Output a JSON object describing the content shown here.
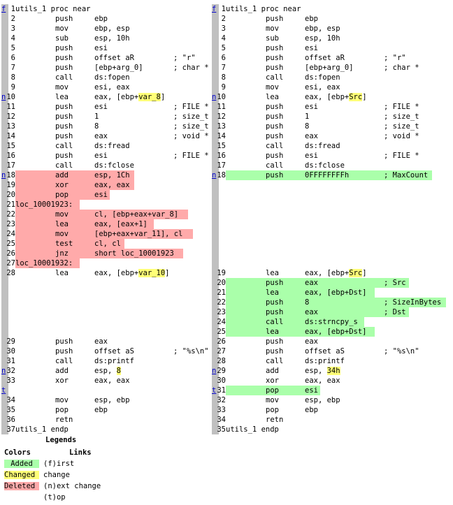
{
  "left_lines": [
    {
      "gutter": "f",
      "num": "1",
      "label": "utils_1 proc near",
      "instr": "",
      "ops": "",
      "comment": ""
    },
    {
      "num": "2",
      "instr": "push",
      "ops": "ebp"
    },
    {
      "num": "3",
      "instr": "mov",
      "ops": "ebp, esp"
    },
    {
      "num": "4",
      "instr": "sub",
      "ops": "esp, 10h"
    },
    {
      "num": "5",
      "instr": "push",
      "ops": "esi"
    },
    {
      "num": "6",
      "instr": "push",
      "ops": "offset aR",
      "comment": "; \"r\""
    },
    {
      "num": "7",
      "instr": "push",
      "ops": "[ebp+arg_0]",
      "comment": "; char *"
    },
    {
      "num": "8",
      "instr": "call",
      "ops": "ds:fopen"
    },
    {
      "num": "9",
      "instr": "mov",
      "ops": "esi, eax"
    },
    {
      "gutter": "n",
      "num": "10",
      "instr": "lea",
      "ops_pre": "eax, [ebp+",
      "ops_chg": "var_8",
      "ops_post": "]"
    },
    {
      "num": "11",
      "instr": "push",
      "ops": "esi",
      "comment": "; FILE *"
    },
    {
      "num": "12",
      "instr": "push",
      "ops": "1",
      "comment": "; size_t"
    },
    {
      "num": "13",
      "instr": "push",
      "ops": "8",
      "comment": "; size_t"
    },
    {
      "num": "14",
      "instr": "push",
      "ops": "eax",
      "comment": "; void *"
    },
    {
      "num": "15",
      "instr": "call",
      "ops": "ds:fread"
    },
    {
      "num": "16",
      "instr": "push",
      "ops": "esi",
      "comment": "; FILE *"
    },
    {
      "num": "17",
      "instr": "call",
      "ops": "ds:fclose"
    },
    {
      "gutter": "n",
      "num": "18",
      "instr": "add",
      "ops": "esp, 1Ch",
      "hl": "del",
      "hlw": 190
    },
    {
      "num": "19",
      "instr": "xor",
      "ops": "eax, eax",
      "hl": "del",
      "hlw": 190
    },
    {
      "num": "20",
      "instr": "pop",
      "ops": "esi",
      "hl": "del",
      "hlw": 155
    },
    {
      "num": "21",
      "label": "loc_10001923:",
      "hl": "del",
      "hlw": 112
    },
    {
      "num": "22",
      "instr": "mov",
      "ops": "cl, [ebp+eax+var_8]",
      "hl": "del",
      "hlw": 267
    },
    {
      "num": "23",
      "instr": "lea",
      "ops": "eax, [eax+1]",
      "hl": "del",
      "hlw": 218
    },
    {
      "num": "24",
      "instr": "mov",
      "ops": "[ebp+eax+var_11], cl",
      "hl": "del",
      "hlw": 274
    },
    {
      "num": "25",
      "instr": "test",
      "ops": "cl, cl",
      "hl": "del",
      "hlw": 176
    },
    {
      "num": "26",
      "instr": "jnz",
      "ops": "short loc_10001923",
      "hl": "del",
      "hlw": 260
    },
    {
      "num": "27",
      "label": "loc_10001932:",
      "hl": "del",
      "hlw": 112
    },
    {
      "num": "28",
      "instr": "lea",
      "ops_pre": "eax, [ebp+",
      "ops_chg": "var_10",
      "ops_post": "]"
    },
    {
      "blank": true
    },
    {
      "blank": true
    },
    {
      "blank": true
    },
    {
      "blank": true
    },
    {
      "blank": true
    },
    {
      "blank": true
    },
    {
      "num": "29",
      "instr": "push",
      "ops": "eax"
    },
    {
      "num": "30",
      "instr": "push",
      "ops": "offset aS",
      "comment": "; \"%s\\n\""
    },
    {
      "num": "31",
      "instr": "call",
      "ops": "ds:printf"
    },
    {
      "gutter": "n",
      "num": "32",
      "instr": "add",
      "ops_pre": "esp, ",
      "ops_chg": "8",
      "ops_post": ""
    },
    {
      "num": "33",
      "instr": "xor",
      "ops": "eax, eax"
    },
    {
      "gutter": "t",
      "blank": true
    },
    {
      "num": "34",
      "instr": "mov",
      "ops": "esp, ebp"
    },
    {
      "num": "35",
      "instr": "pop",
      "ops": "ebp"
    },
    {
      "num": "36",
      "instr": "retn",
      "ops": ""
    },
    {
      "num": "37",
      "label": "utils_1 endp"
    }
  ],
  "right_lines": [
    {
      "gutter": "f",
      "num": "1",
      "label": "utils_1 proc near"
    },
    {
      "num": "2",
      "instr": "push",
      "ops": "ebp"
    },
    {
      "num": "3",
      "instr": "mov",
      "ops": "ebp, esp"
    },
    {
      "num": "4",
      "instr": "sub",
      "ops": "esp, 10h"
    },
    {
      "num": "5",
      "instr": "push",
      "ops": "esi"
    },
    {
      "num": "6",
      "instr": "push",
      "ops": "offset aR",
      "comment": "; \"r\""
    },
    {
      "num": "7",
      "instr": "push",
      "ops": "[ebp+arg_0]",
      "comment": "; char *"
    },
    {
      "num": "8",
      "instr": "call",
      "ops": "ds:fopen"
    },
    {
      "num": "9",
      "instr": "mov",
      "ops": "esi, eax"
    },
    {
      "gutter": "n",
      "num": "10",
      "instr": "lea",
      "ops_pre": "eax, [ebp+",
      "ops_chg": "Src",
      "ops_post": "]"
    },
    {
      "num": "11",
      "instr": "push",
      "ops": "esi",
      "comment": "; FILE *"
    },
    {
      "num": "12",
      "instr": "push",
      "ops": "1",
      "comment": "; size_t"
    },
    {
      "num": "13",
      "instr": "push",
      "ops": "8",
      "comment": "; size_t"
    },
    {
      "num": "14",
      "instr": "push",
      "ops": "eax",
      "comment": "; void *"
    },
    {
      "num": "15",
      "instr": "call",
      "ops": "ds:fread"
    },
    {
      "num": "16",
      "instr": "push",
      "ops": "esi",
      "comment": "; FILE *"
    },
    {
      "num": "17",
      "instr": "call",
      "ops": "ds:fclose"
    },
    {
      "gutter": "n",
      "num": "18",
      "instr": "push",
      "ops": "0FFFFFFFFh",
      "comment": "; MaxCount",
      "hl": "add",
      "hlw": 315
    },
    {
      "blank": true
    },
    {
      "blank": true
    },
    {
      "blank": true
    },
    {
      "blank": true
    },
    {
      "blank": true
    },
    {
      "blank": true
    },
    {
      "blank": true
    },
    {
      "blank": true
    },
    {
      "blank": true
    },
    {
      "num": "19",
      "instr": "lea",
      "ops_pre": "eax, [ebp+",
      "ops_chg": "Src",
      "ops_post": "]"
    },
    {
      "num": "20",
      "instr": "push",
      "ops": "eax",
      "comment": "; Src",
      "hl": "add",
      "hlw": 282
    },
    {
      "num": "21",
      "instr": "lea",
      "ops": "eax, [ebp+Dst]",
      "hl": "add",
      "hlw": 233
    },
    {
      "num": "22",
      "instr": "push",
      "ops": "8",
      "comment": "; SizeInBytes",
      "hl": "add",
      "hlw": 335
    },
    {
      "num": "23",
      "instr": "push",
      "ops": "eax",
      "comment": "; Dst",
      "hl": "add",
      "hlw": 282
    },
    {
      "num": "24",
      "instr": "call",
      "ops": "ds:strncpy_s",
      "hl": "add",
      "hlw": 218
    },
    {
      "num": "25",
      "instr": "lea",
      "ops": "eax, [ebp+Dst]",
      "hl": "add",
      "hlw": 233
    },
    {
      "num": "26",
      "instr": "push",
      "ops": "eax"
    },
    {
      "num": "27",
      "instr": "push",
      "ops": "offset aS",
      "comment": "; \"%s\\n\""
    },
    {
      "num": "28",
      "instr": "call",
      "ops": "ds:printf"
    },
    {
      "gutter": "n",
      "num": "29",
      "instr": "add",
      "ops_pre": "esp, ",
      "ops_chg": "34h",
      "ops_post": ""
    },
    {
      "num": "30",
      "instr": "xor",
      "ops": "eax, eax"
    },
    {
      "gutter": "t",
      "num": "31",
      "instr": "pop",
      "ops": "esi",
      "hl": "add",
      "hlw": 155
    },
    {
      "num": "32",
      "instr": "mov",
      "ops": "esp, ebp"
    },
    {
      "num": "33",
      "instr": "pop",
      "ops": "ebp"
    },
    {
      "num": "34",
      "instr": "retn",
      "ops": ""
    },
    {
      "num": "35",
      "label": "utils_1 endp"
    }
  ],
  "legend": {
    "title": "Legends",
    "colors_heading": "Colors",
    "links_heading": "Links",
    "added": "Added",
    "changed": "Changed",
    "deleted": "Deleted",
    "link_first": "(f)irst",
    "link_change": "change",
    "link_next": "(n)ext change",
    "link_top": "(t)op",
    "colors": {
      "added": "#aaffaa",
      "changed": "#ffff77",
      "deleted": "#ffaaaa",
      "gutter": "#c0c0c0",
      "link": "#0000cc"
    }
  }
}
